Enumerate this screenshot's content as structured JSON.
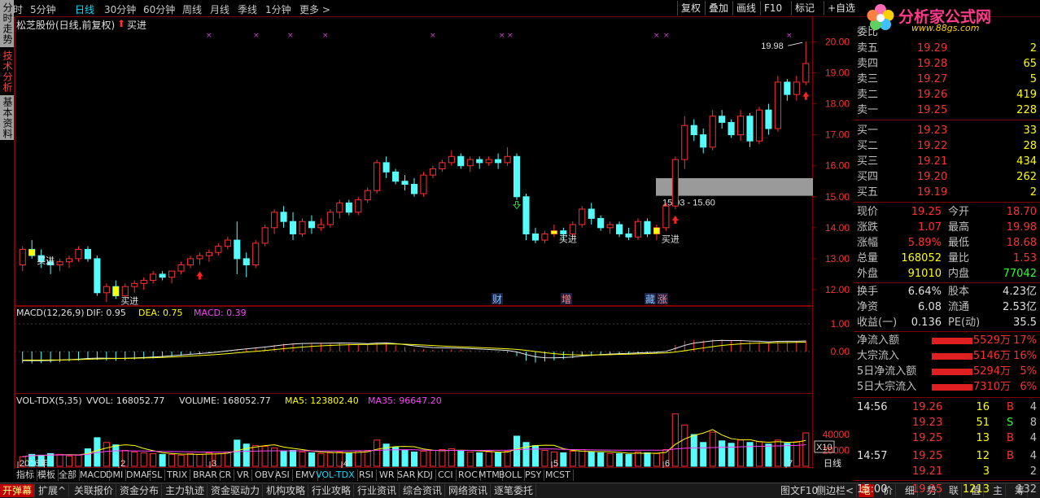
{
  "periods": [
    "分时",
    "5分钟",
    "日线",
    "30分钟",
    "60分钟",
    "周线",
    "月线",
    "季线",
    "1分钟",
    "更多 >"
  ],
  "active_period": "日线",
  "toolbar_right": [
    "复权",
    "叠加",
    "画线",
    "F10",
    "标记",
    "+自选"
  ],
  "left_tabs": [
    "分时走势",
    "技术分析",
    "基本资料"
  ],
  "title": "松芝股份(日线,前复权)",
  "title_signal": "买进",
  "price_axis": [
    "20.00",
    "19.00",
    "18.00",
    "17.00",
    "16.00",
    "15.00",
    "14.00",
    "13.00",
    "12.00"
  ],
  "high_label": "19.98",
  "zone_label": "15.03 - 15.60",
  "buy_label": "买进",
  "event_marks": [
    "财",
    "增",
    "藏",
    "涨"
  ],
  "macd_header": {
    "name": "MACD(12,26,9)",
    "dif": "DIF: 0.95",
    "dea": "DEA: 0.75",
    "macd": "MACD: 0.39"
  },
  "macd_axis": [
    "1.00",
    "0.00"
  ],
  "vol_header": {
    "name": "VOL-TDX(5,35)",
    "vvol": "VVOL: 168052.77",
    "volume": "VOLUME: 168052.77",
    "ma5": "MA5: 123802.40",
    "ma35": "MA35: 96647.20"
  },
  "vol_axis": [
    "40000",
    "20000"
  ],
  "vol_unit": "X10",
  "date_axis": [
    "2016年",
    "2",
    "3",
    "4",
    "5",
    "6",
    "7"
  ],
  "date_axis_right": "日线",
  "indicator_tabs": [
    "指标",
    "模板",
    "全部",
    "MACD",
    "DMI",
    "DMA",
    "FSL",
    "TRIX",
    "BRAR",
    "CR",
    "VR",
    "OBV",
    "ASI",
    "EMV",
    "VOL-TDX",
    "RSI",
    "WR",
    "SAR",
    "KDJ",
    "CCI",
    "ROC",
    "MTM",
    "BOLL",
    "PSY",
    "MCST"
  ],
  "active_indicator": "VOL-TDX",
  "bottom_tabs": [
    "开弹幕",
    "扩展^",
    "关联报价",
    "资金分布",
    "主力轨迹",
    "资金驱动力",
    "机构攻略",
    "行业攻略",
    "行业资讯",
    "综合资讯",
    "网络资讯",
    "逐笔委托"
  ],
  "bottom_right": [
    "图文F10",
    "侧边栏<",
    "笔",
    "价",
    "细",
    "势",
    "联",
    "值",
    "主",
    "筹"
  ],
  "logo": {
    "title": "分析家公式网",
    "url": "www.88gs.com"
  },
  "order_header": "委比",
  "asks": [
    {
      "label": "卖五",
      "price": "19.29",
      "vol": "2"
    },
    {
      "label": "卖四",
      "price": "19.28",
      "vol": "65"
    },
    {
      "label": "卖三",
      "price": "19.27",
      "vol": "5"
    },
    {
      "label": "卖二",
      "price": "19.26",
      "vol": "419"
    },
    {
      "label": "卖一",
      "price": "19.25",
      "vol": "228"
    }
  ],
  "bids": [
    {
      "label": "买一",
      "price": "19.23",
      "vol": "33"
    },
    {
      "label": "买二",
      "price": "19.22",
      "vol": "28"
    },
    {
      "label": "买三",
      "price": "19.21",
      "vol": "434"
    },
    {
      "label": "买四",
      "price": "19.20",
      "vol": "262"
    },
    {
      "label": "买五",
      "price": "19.19",
      "vol": "2"
    }
  ],
  "quote": [
    {
      "l1": "现价",
      "v1": "19.25",
      "l2": "今开",
      "v2": "18.70"
    },
    {
      "l1": "涨跌",
      "v1": "1.07",
      "l2": "最高",
      "v2": "19.98"
    },
    {
      "l1": "涨幅",
      "v1": "5.89%",
      "l2": "最低",
      "v2": "18.68"
    },
    {
      "l1": "总量",
      "v1": "168052",
      "l2": "量比",
      "v2": "1.53"
    },
    {
      "l1": "外盘",
      "v1": "91010",
      "l2": "内盘",
      "v2": "77042"
    }
  ],
  "fund": [
    {
      "l1": "换手",
      "v1": "6.64%",
      "l2": "股本",
      "v2": "4.23亿"
    },
    {
      "l1": "净资",
      "v1": "6.08",
      "l2": "流通",
      "v2": "2.53亿"
    },
    {
      "l1": "收益(一)",
      "v1": "0.136",
      "l2": "PE(动)",
      "v2": "35.5"
    }
  ],
  "flows": [
    {
      "label": "净流入额",
      "value": "5529万",
      "pct": "17%"
    },
    {
      "label": "大宗流入",
      "value": "5146万",
      "pct": "16%"
    },
    {
      "label": "5日净流入额",
      "value": "5294万",
      "pct": "5%"
    },
    {
      "label": "5日大宗流入",
      "value": "7310万",
      "pct": "6%"
    }
  ],
  "ticks": [
    {
      "time": "14:56",
      "price": "19.26",
      "vol": "16",
      "side": "B",
      "n": "4"
    },
    {
      "time": "",
      "price": "19.23",
      "vol": "51",
      "side": "S",
      "n": "8"
    },
    {
      "time": "",
      "price": "19.25",
      "vol": "13",
      "side": "B",
      "n": "4"
    },
    {
      "time": "14:57",
      "price": "19.25",
      "vol": "12",
      "side": "B",
      "n": "4"
    },
    {
      "time": "",
      "price": "19.21",
      "vol": "3",
      "side": "",
      "n": "2"
    },
    {
      "time": "15:00",
      "price": "19.25",
      "vol": "1213",
      "side": "",
      "n": "132"
    }
  ],
  "chart_data": {
    "type": "candlestick",
    "y_range": [
      11.5,
      20.3
    ],
    "candles": [
      [
        12.8,
        13.4,
        12.6,
        13.3
      ],
      [
        13.3,
        13.6,
        13.0,
        13.1
      ],
      [
        13.1,
        13.3,
        12.7,
        12.9
      ],
      [
        12.9,
        13.0,
        12.5,
        12.8
      ],
      [
        12.8,
        13.0,
        12.6,
        12.9
      ],
      [
        12.9,
        13.1,
        12.7,
        13.0
      ],
      [
        13.0,
        13.4,
        12.9,
        13.3
      ],
      [
        13.3,
        13.4,
        12.9,
        13.0
      ],
      [
        13.0,
        13.1,
        11.8,
        11.9
      ],
      [
        11.9,
        12.2,
        11.6,
        12.1
      ],
      [
        12.1,
        12.3,
        11.7,
        11.8
      ],
      [
        11.8,
        12.2,
        11.7,
        12.1
      ],
      [
        12.1,
        12.3,
        11.9,
        12.2
      ],
      [
        12.2,
        12.4,
        12.0,
        12.3
      ],
      [
        12.3,
        12.6,
        12.2,
        12.5
      ],
      [
        12.5,
        12.6,
        12.3,
        12.4
      ],
      [
        12.4,
        12.6,
        12.2,
        12.6
      ],
      [
        12.6,
        12.9,
        12.5,
        12.8
      ],
      [
        12.8,
        13.1,
        12.7,
        13.0
      ],
      [
        13.0,
        13.2,
        12.8,
        13.1
      ],
      [
        13.1,
        13.3,
        12.9,
        13.2
      ],
      [
        13.2,
        13.5,
        13.1,
        13.4
      ],
      [
        13.4,
        13.7,
        13.3,
        13.6
      ],
      [
        13.6,
        14.2,
        12.5,
        13.0
      ],
      [
        13.0,
        13.2,
        12.4,
        12.8
      ],
      [
        12.8,
        13.6,
        12.7,
        13.5
      ],
      [
        13.5,
        14.1,
        13.4,
        14.0
      ],
      [
        14.0,
        14.6,
        13.8,
        14.5
      ],
      [
        14.5,
        14.7,
        14.0,
        14.2
      ],
      [
        14.2,
        14.5,
        13.6,
        13.8
      ],
      [
        13.8,
        14.3,
        13.7,
        14.2
      ],
      [
        14.2,
        14.4,
        13.8,
        14.0
      ],
      [
        14.0,
        14.3,
        13.9,
        14.1
      ],
      [
        14.1,
        14.6,
        14.0,
        14.5
      ],
      [
        14.5,
        14.9,
        14.3,
        14.8
      ],
      [
        14.8,
        14.9,
        14.4,
        14.5
      ],
      [
        14.5,
        15.0,
        14.4,
        14.9
      ],
      [
        14.9,
        15.3,
        14.8,
        15.2
      ],
      [
        15.2,
        16.2,
        15.1,
        16.1
      ],
      [
        16.1,
        16.3,
        15.6,
        15.8
      ],
      [
        15.8,
        15.9,
        15.4,
        15.5
      ],
      [
        15.5,
        15.7,
        15.2,
        15.4
      ],
      [
        15.4,
        15.6,
        15.0,
        15.1
      ],
      [
        15.1,
        15.8,
        15.0,
        15.7
      ],
      [
        15.7,
        16.0,
        15.6,
        15.9
      ],
      [
        15.9,
        16.2,
        15.8,
        16.1
      ],
      [
        16.1,
        16.5,
        16.0,
        16.3
      ],
      [
        16.3,
        16.4,
        15.9,
        16.0
      ],
      [
        16.0,
        16.3,
        15.8,
        16.2
      ],
      [
        16.2,
        16.3,
        15.9,
        16.1
      ],
      [
        16.1,
        16.3,
        16.0,
        16.2
      ],
      [
        16.2,
        16.4,
        15.9,
        16.1
      ],
      [
        16.1,
        16.6,
        16.0,
        16.3
      ],
      [
        16.3,
        16.4,
        14.9,
        15.0
      ],
      [
        15.0,
        15.1,
        13.6,
        13.8
      ],
      [
        13.8,
        14.0,
        13.5,
        13.6
      ],
      [
        13.6,
        13.9,
        13.5,
        13.8
      ],
      [
        13.8,
        14.1,
        13.7,
        13.9
      ],
      [
        13.9,
        14.0,
        13.6,
        13.8
      ],
      [
        13.8,
        14.2,
        13.7,
        14.1
      ],
      [
        14.1,
        14.7,
        14.0,
        14.6
      ],
      [
        14.6,
        14.8,
        14.1,
        14.3
      ],
      [
        14.3,
        14.4,
        13.9,
        14.0
      ],
      [
        14.0,
        14.2,
        13.8,
        14.1
      ],
      [
        14.1,
        14.2,
        13.7,
        13.8
      ],
      [
        13.8,
        14.0,
        13.6,
        13.7
      ],
      [
        13.7,
        14.3,
        13.6,
        14.2
      ],
      [
        14.2,
        14.3,
        13.7,
        13.8
      ],
      [
        13.8,
        14.1,
        13.6,
        14.0
      ],
      [
        14.0,
        14.8,
        13.9,
        14.7
      ],
      [
        14.7,
        16.3,
        14.6,
        16.2
      ],
      [
        16.2,
        17.6,
        15.9,
        17.3
      ],
      [
        17.3,
        17.5,
        16.8,
        17.0
      ],
      [
        17.0,
        17.2,
        16.4,
        16.6
      ],
      [
        16.6,
        17.8,
        16.5,
        17.6
      ],
      [
        17.6,
        17.8,
        17.2,
        17.4
      ],
      [
        17.4,
        17.5,
        16.9,
        17.0
      ],
      [
        17.0,
        17.8,
        16.8,
        17.6
      ],
      [
        17.6,
        17.7,
        16.6,
        16.8
      ],
      [
        16.8,
        17.9,
        16.7,
        17.8
      ],
      [
        17.8,
        18.0,
        17.0,
        17.2
      ],
      [
        17.2,
        18.9,
        17.1,
        18.7
      ],
      [
        18.7,
        18.8,
        18.1,
        18.3
      ],
      [
        18.3,
        18.9,
        18.1,
        18.7
      ],
      [
        18.7,
        20.0,
        18.6,
        19.3
      ]
    ],
    "volume": [
      120,
      150,
      140,
      160,
      150,
      130,
      140,
      220,
      360,
      300,
      270,
      200,
      180,
      170,
      160,
      150,
      150,
      140,
      160,
      150,
      170,
      160,
      180,
      330,
      280,
      260,
      250,
      230,
      190,
      200,
      180,
      170,
      160,
      170,
      180,
      170,
      190,
      200,
      330,
      280,
      240,
      200,
      180,
      190,
      200,
      210,
      220,
      190,
      180,
      170,
      180,
      170,
      190,
      380,
      300,
      260,
      200,
      180,
      170,
      190,
      210,
      180,
      170,
      160,
      160,
      150,
      180,
      170,
      160,
      210,
      660,
      520,
      400,
      300,
      430,
      320,
      290,
      330,
      300,
      310,
      280,
      330,
      290,
      310,
      420
    ],
    "macd": [
      -0.42,
      -0.43,
      -0.42,
      -0.4,
      -0.38,
      -0.36,
      -0.33,
      -0.29,
      -0.3,
      -0.33,
      -0.34,
      -0.32,
      -0.29,
      -0.27,
      -0.25,
      -0.22,
      -0.18,
      -0.15,
      -0.12,
      -0.1,
      -0.06,
      -0.02,
      0.04,
      0.08,
      0.1,
      0.14,
      0.18,
      0.24,
      0.28,
      0.3,
      0.3,
      0.28,
      0.28,
      0.28,
      0.3,
      0.28,
      0.26,
      0.24,
      0.32,
      0.3,
      0.22,
      0.16,
      0.1,
      0.08,
      0.06,
      0.08,
      0.08,
      0.06,
      0.04,
      0.02,
      0.0,
      -0.02,
      -0.04,
      -0.16,
      -0.33,
      -0.4,
      -0.36,
      -0.32,
      -0.28,
      -0.24,
      -0.18,
      -0.16,
      -0.14,
      -0.12,
      -0.12,
      -0.11,
      -0.08,
      -0.08,
      -0.06,
      0.0,
      0.24,
      0.38,
      0.42,
      0.4,
      0.44,
      0.42,
      0.38,
      0.38,
      0.34,
      0.34,
      0.3,
      0.38,
      0.36,
      0.36,
      0.39
    ]
  },
  "colors": {
    "up": "#ff3030",
    "down": "#54fcfc",
    "ma5": "#e0e0e0",
    "ma35": "#ffff00",
    "frame": "#800000",
    "zone": "#9a9a9a",
    "buy": "#ffff00"
  }
}
